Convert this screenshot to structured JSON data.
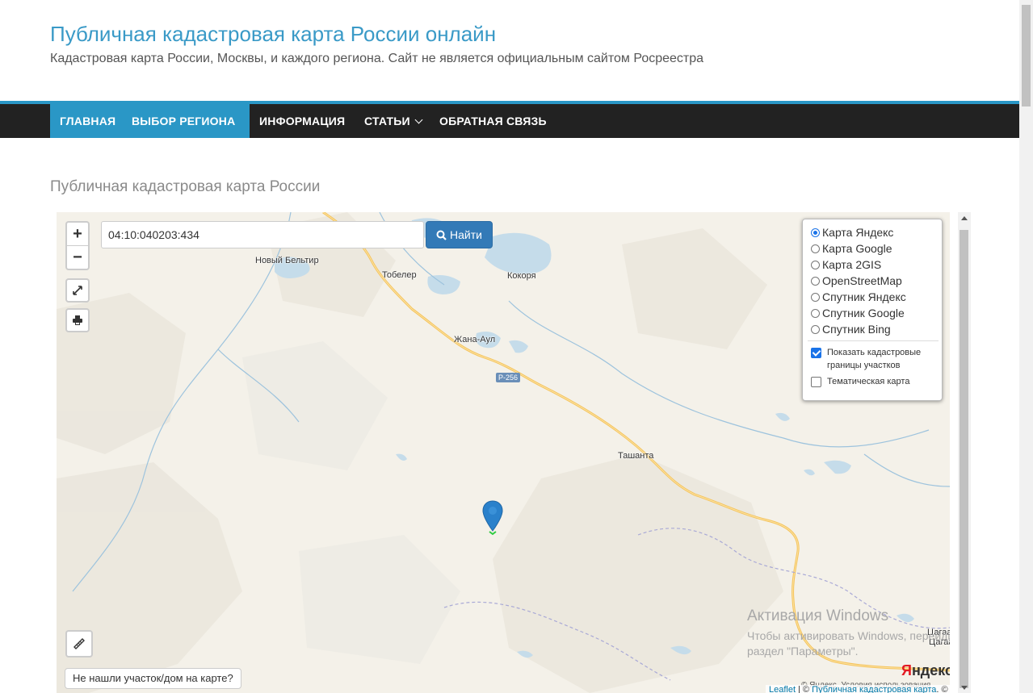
{
  "site": {
    "title": "Публичная кадастровая карта России онлайн",
    "description": "Кадастровая карта России, Москвы, и каждого региона. Сайт не является официальным сайтом Росреестра"
  },
  "nav": {
    "items": [
      {
        "label": "ГЛАВНАЯ"
      },
      {
        "label": "ВЫБОР РЕГИОНА"
      },
      {
        "label": "ИНФОРМАЦИЯ"
      },
      {
        "label": "СТАТЬИ"
      },
      {
        "label": "ОБРАТНАЯ СВЯЗЬ"
      }
    ],
    "accent": "#2a97c6",
    "background": "#222222"
  },
  "page": {
    "heading": "Публичная кадастровая карта России"
  },
  "map": {
    "zoom_in": "+",
    "zoom_out": "−",
    "search": {
      "value": "04:10:040203:434",
      "button_label": "Найти"
    },
    "layers": [
      {
        "label": "Карта Яндекс",
        "selected": true
      },
      {
        "label": "Карта Google",
        "selected": false
      },
      {
        "label": "Карта 2GIS",
        "selected": false
      },
      {
        "label": "OpenStreetMap",
        "selected": false
      },
      {
        "label": "Спутник Яндекс",
        "selected": false
      },
      {
        "label": "Спутник Google",
        "selected": false
      },
      {
        "label": "Спутник Bing",
        "selected": false
      }
    ],
    "overlays": [
      {
        "label": "Показать кадастровые границы участков",
        "checked": true
      },
      {
        "label": "Тематическая карта",
        "checked": false
      }
    ],
    "not_found_label": "Не нашли участок/дом на карте?",
    "places": {
      "novy_beltir": "Новый Бельтир",
      "tobeler": "Тобелер",
      "kokorya": "Кокоря",
      "zhana_aul": "Жана-Аул",
      "tashanta": "Ташанта",
      "tsagaa1": "Цагаа",
      "tsagaa2": "Цагаа"
    },
    "road_label": "Р-256",
    "yandex_logo_y": "Я",
    "yandex_logo_rest": "ндекс",
    "yandex_attribution": "© Яндекс. Условия использования",
    "leaflet_link": "Leaflet",
    "attribution_sep": " | © ",
    "attribution_link": "Публичная кадастровая карта",
    "attribution_tail": ". ©"
  },
  "windows_watermark": {
    "title": "Активация Windows",
    "text": "Чтобы активировать Windows, перейдите в раздел \"Параметры\"."
  }
}
